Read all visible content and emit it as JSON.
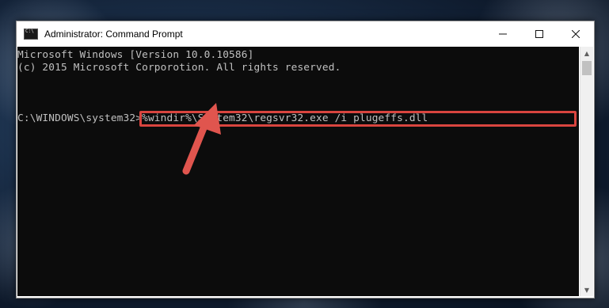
{
  "window": {
    "title": "Administrator: Command Prompt",
    "controls": {
      "minimize": "minimize",
      "maximize": "maximize",
      "close": "close"
    }
  },
  "console": {
    "lines": [
      "Microsoft Windows [Version 10.0.10586]",
      "(c) 2015 Microsoft Corporotion. All rights reserved.",
      ""
    ],
    "prompt": "C:\\WINDOWS\\system32>",
    "command": "%windir%\\System32\\regsvr32.exe /i plugeffs.dll"
  },
  "colors": {
    "console_bg": "#0c0c0c",
    "console_text": "#c0c0c0",
    "highlight": "#d9453f",
    "arrow": "#e0554e"
  },
  "icons": [
    "cmd-app-icon",
    "minimize-icon",
    "maximize-icon",
    "close-icon",
    "scroll-up-icon",
    "scroll-down-icon",
    "red-arrow-icon"
  ]
}
